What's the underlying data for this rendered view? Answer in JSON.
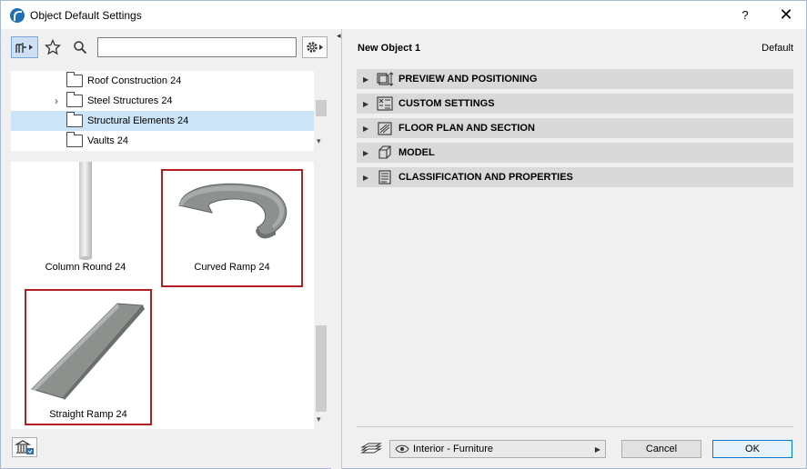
{
  "window": {
    "title": "Object Default Settings",
    "help": "?",
    "close": "✕"
  },
  "library": {
    "search_placeholder": "",
    "tree": [
      {
        "label": "Roof Construction 24",
        "expandable": false,
        "selected": false
      },
      {
        "label": "Steel Structures 24",
        "expandable": true,
        "selected": false
      },
      {
        "label": "Structural Elements 24",
        "expandable": false,
        "selected": true
      },
      {
        "label": "Vaults 24",
        "expandable": false,
        "selected": false
      }
    ],
    "items": [
      {
        "label": "Column Round 24",
        "highlighted": false
      },
      {
        "label": "Curved Ramp 24",
        "highlighted": true
      },
      {
        "label": "Straight Ramp 24",
        "highlighted": true
      }
    ]
  },
  "settings": {
    "object_name": "New Object 1",
    "default_label": "Default",
    "panels": [
      {
        "label": "PREVIEW AND POSITIONING",
        "icon": "preview-icon"
      },
      {
        "label": "CUSTOM SETTINGS",
        "icon": "custom-settings-icon"
      },
      {
        "label": "FLOOR PLAN AND SECTION",
        "icon": "floor-plan-icon"
      },
      {
        "label": "MODEL",
        "icon": "model-cube-icon"
      },
      {
        "label": "CLASSIFICATION AND PROPERTIES",
        "icon": "classification-icon"
      }
    ],
    "layer": "Interior - Furniture",
    "cancel_label": "Cancel",
    "ok_label": "OK"
  },
  "colors": {
    "highlight_border": "#b21e23",
    "selection": "#cce4f7",
    "panel_bg": "#d9d9d9",
    "ok_border": "#0078d7"
  }
}
